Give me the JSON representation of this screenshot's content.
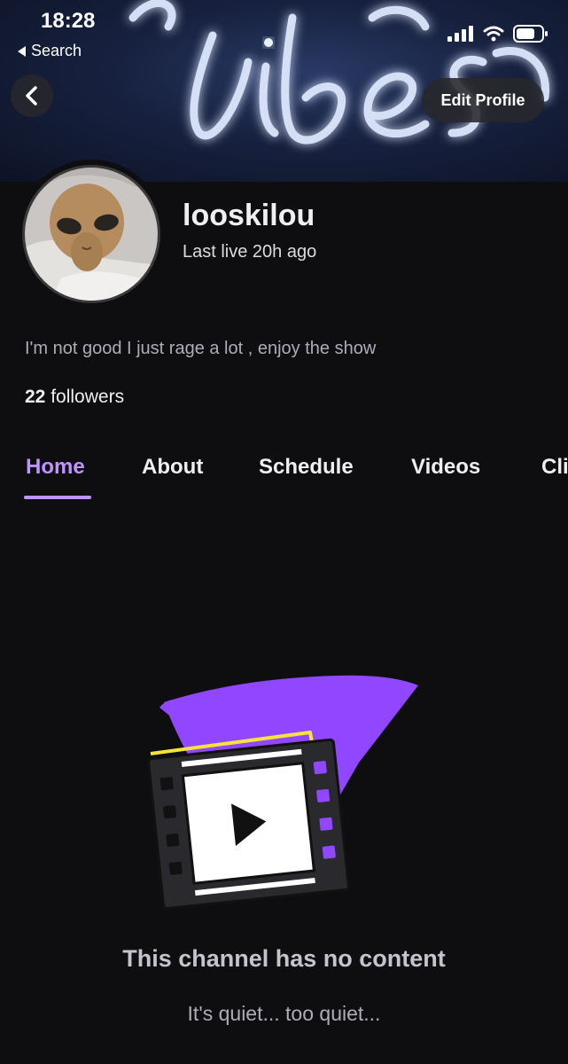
{
  "status_bar": {
    "time": "18:28",
    "back_app_label": "Search",
    "icons": [
      "cellular-signal-icon",
      "wifi-icon",
      "battery-icon"
    ]
  },
  "banner": {
    "description_icon": "neon-sign-banner"
  },
  "header": {
    "back_icon": "chevron-left-icon",
    "edit_profile_label": "Edit Profile"
  },
  "profile": {
    "username": "looskilou",
    "last_live": "Last live 20h ago",
    "bio": "I'm not good I just rage a lot , enjoy the show",
    "followers_count": "22",
    "followers_label": "followers"
  },
  "tabs": [
    {
      "label": "Home",
      "active": true
    },
    {
      "label": "About",
      "active": false
    },
    {
      "label": "Schedule",
      "active": false
    },
    {
      "label": "Videos",
      "active": false
    },
    {
      "label": "Cli",
      "active": false
    }
  ],
  "empty_state": {
    "icon": "film-strip-play-icon",
    "title": "This channel has no content",
    "subtitle": "It's quiet... too quiet..."
  },
  "colors": {
    "background": "#0e0e10",
    "accent": "#bf94ff",
    "brand_purple": "#9147ff",
    "highlight_yellow": "#f5e33b"
  }
}
